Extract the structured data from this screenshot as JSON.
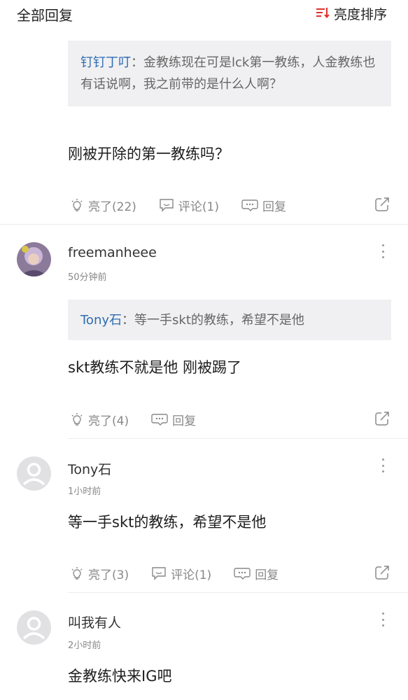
{
  "header": {
    "title": "全部回复",
    "sort_label": "亮度排序",
    "accent": "#e0322b"
  },
  "comments": [
    {
      "quote": {
        "name": "钉钉丁叮",
        "separator": "：",
        "text": "金教练现在可是lck第一教练，人金教练也有话说啊，我之前带的是什么人啊？"
      },
      "content": "刚被开除的第一教练吗？",
      "actions": {
        "like": "亮了(22)",
        "comment": "评论(1)",
        "reply": "回复"
      }
    },
    {
      "username": "freemanheee",
      "time": "50分钟前",
      "quote": {
        "name": "Tony石",
        "separator": "：",
        "text": "等一手skt的教练，希望不是他"
      },
      "content": "skt教练不就是他 刚被踢了",
      "actions": {
        "like": "亮了(4)",
        "reply": "回复"
      }
    },
    {
      "username": "Tony石",
      "time": "1小时前",
      "content": "等一手skt的教练，希望不是他",
      "actions": {
        "like": "亮了(3)",
        "comment": "评论(1)",
        "reply": "回复"
      }
    },
    {
      "username": "叫我有人",
      "time": "2小时前",
      "content": "金教练快来IG吧"
    }
  ]
}
